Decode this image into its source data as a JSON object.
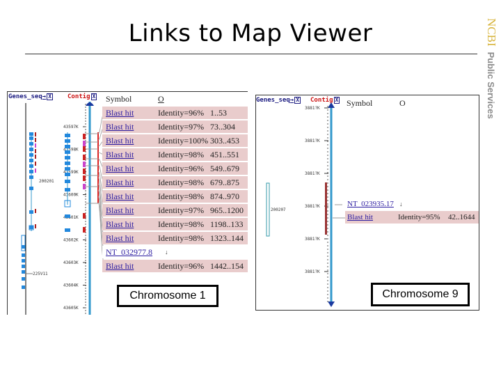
{
  "slide": {
    "title": "Links to Map Viewer",
    "brand": "NCBI",
    "brand_subtitle": "Public Services"
  },
  "panels": [
    {
      "id": "chromosome-1",
      "caption": "Chromosome 1",
      "track_headers": {
        "genes": "Genes_seq",
        "contig": "Contig",
        "arrow": "→",
        "close": "X"
      },
      "columns": {
        "symbol": "Symbol",
        "o": "O"
      },
      "ruler_ticks": [
        "43597K",
        "43598K",
        "43599K",
        "43600K",
        "43601K",
        "43602K",
        "43603K",
        "43604K",
        "43605K"
      ],
      "gene_labels": [
        "200201",
        "225V11"
      ],
      "rows": [
        {
          "type": "hit",
          "link": "Blast hit",
          "identity": "Identity=96%",
          "range": "1..53"
        },
        {
          "type": "hit",
          "link": "Blast hit",
          "identity": "Identity=97%",
          "range": "73..304"
        },
        {
          "type": "hit",
          "link": "Blast hit",
          "identity": "Identity=100%",
          "range": "303..453"
        },
        {
          "type": "hit",
          "link": "Blast hit",
          "identity": "Identity=98%",
          "range": "451..551"
        },
        {
          "type": "hit",
          "link": "Blast hit",
          "identity": "Identity=96%",
          "range": "549..679"
        },
        {
          "type": "hit",
          "link": "Blast hit",
          "identity": "Identity=98%",
          "range": "679..875"
        },
        {
          "type": "hit",
          "link": "Blast hit",
          "identity": "Identity=98%",
          "range": "874..970"
        },
        {
          "type": "hit",
          "link": "Blast hit",
          "identity": "Identity=97%",
          "range": "965..1200"
        },
        {
          "type": "hit",
          "link": "Blast hit",
          "identity": "Identity=98%",
          "range": "1198..133"
        },
        {
          "type": "hit",
          "link": "Blast hit",
          "identity": "Identity=98%",
          "range": "1323..144"
        },
        {
          "type": "nt",
          "link": "NT_032977.8",
          "identity": "",
          "range": ""
        },
        {
          "type": "hit",
          "link": "Blast hit",
          "identity": "Identity=96%",
          "range": "1442..154"
        }
      ]
    },
    {
      "id": "chromosome-9",
      "caption": "Chromosome 9",
      "track_headers": {
        "genes": "Genes_seq",
        "contig": "Contig",
        "arrow": "→",
        "close": "X"
      },
      "columns": {
        "symbol": "Symbol",
        "o": "O"
      },
      "ruler_ticks": [
        "3881?K",
        "3881?K",
        "3881?K",
        "3881?K",
        "3881?K",
        "3881?K"
      ],
      "gene_labels": [
        "200207"
      ],
      "rows": [
        {
          "type": "nt",
          "link": "NT_023935.17",
          "identity": "",
          "range": ""
        },
        {
          "type": "hit",
          "link": "Blast hit",
          "identity": "Identity=95%",
          "range": "42..1644"
        }
      ]
    }
  ]
}
